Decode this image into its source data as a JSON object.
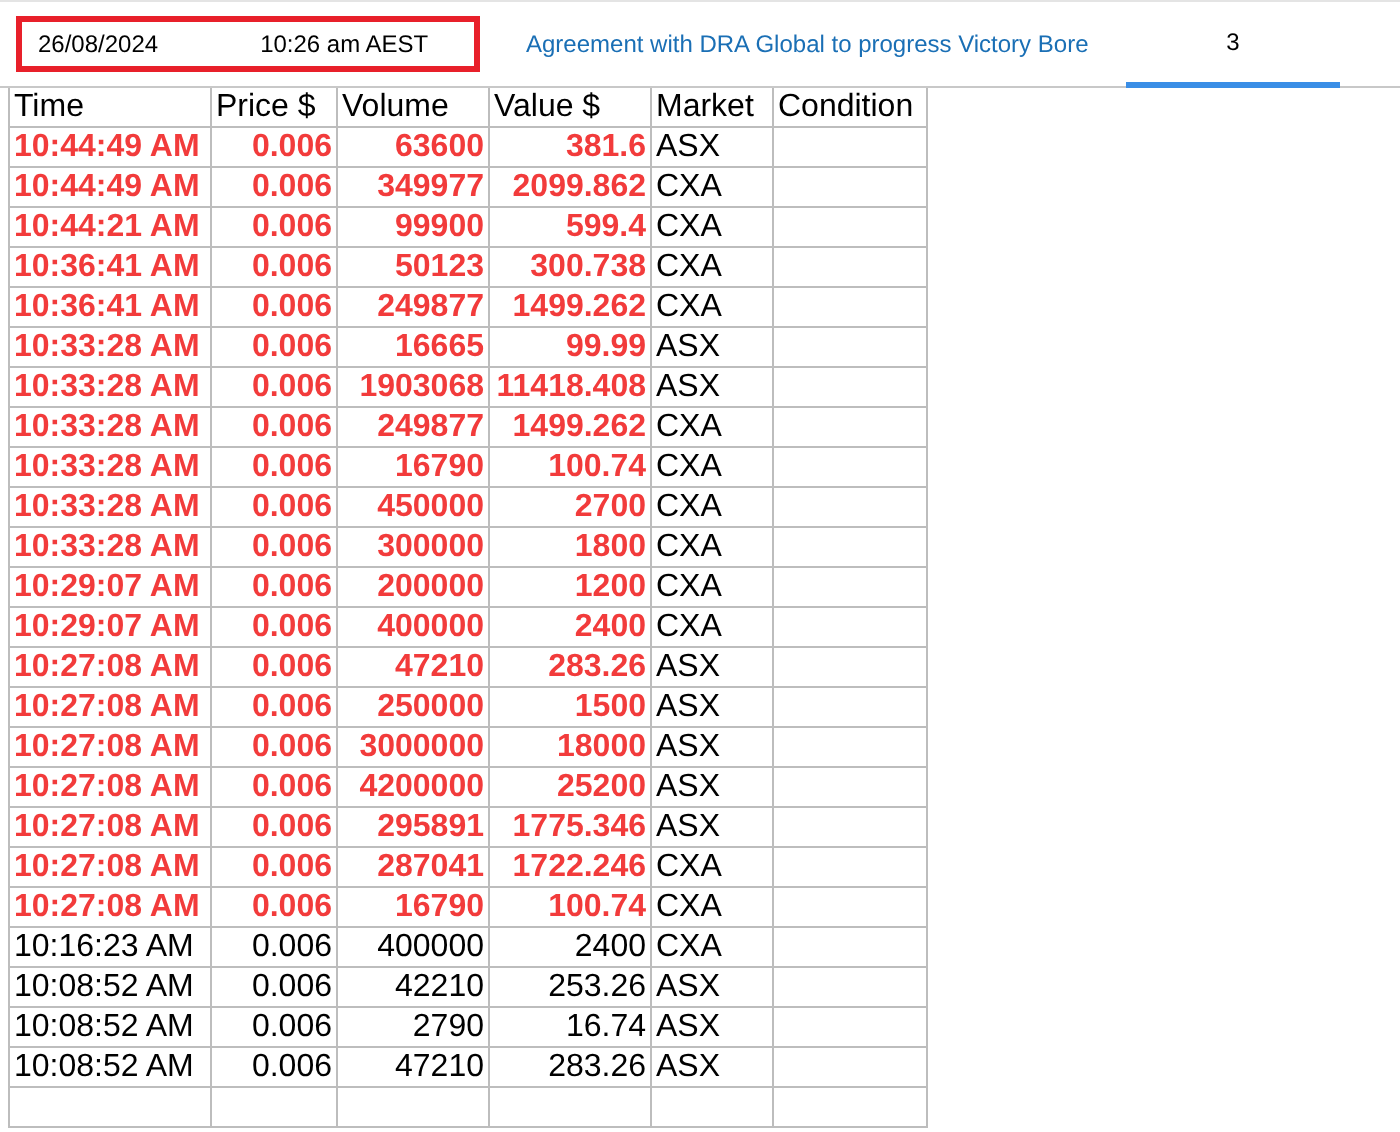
{
  "header": {
    "date": "26/08/2024",
    "time": "10:26 am AEST",
    "headline": "Agreement with DRA Global to progress Victory Bore",
    "count": "3"
  },
  "table": {
    "columns": [
      "Time",
      "Price $",
      "Volume",
      "Value $",
      "Market",
      "Condition"
    ],
    "rows": [
      {
        "time": "10:44:49 AM",
        "price": "0.006",
        "volume": "63600",
        "value": "381.6",
        "market": "ASX",
        "highlighted": true
      },
      {
        "time": "10:44:49 AM",
        "price": "0.006",
        "volume": "349977",
        "value": "2099.862",
        "market": "CXA",
        "highlighted": true
      },
      {
        "time": "10:44:21 AM",
        "price": "0.006",
        "volume": "99900",
        "value": "599.4",
        "market": "CXA",
        "highlighted": true
      },
      {
        "time": "10:36:41 AM",
        "price": "0.006",
        "volume": "50123",
        "value": "300.738",
        "market": "CXA",
        "highlighted": true
      },
      {
        "time": "10:36:41 AM",
        "price": "0.006",
        "volume": "249877",
        "value": "1499.262",
        "market": "CXA",
        "highlighted": true
      },
      {
        "time": "10:33:28 AM",
        "price": "0.006",
        "volume": "16665",
        "value": "99.99",
        "market": "ASX",
        "highlighted": true
      },
      {
        "time": "10:33:28 AM",
        "price": "0.006",
        "volume": "1903068",
        "value": "11418.408",
        "market": "ASX",
        "highlighted": true
      },
      {
        "time": "10:33:28 AM",
        "price": "0.006",
        "volume": "249877",
        "value": "1499.262",
        "market": "CXA",
        "highlighted": true
      },
      {
        "time": "10:33:28 AM",
        "price": "0.006",
        "volume": "16790",
        "value": "100.74",
        "market": "CXA",
        "highlighted": true
      },
      {
        "time": "10:33:28 AM",
        "price": "0.006",
        "volume": "450000",
        "value": "2700",
        "market": "CXA",
        "highlighted": true
      },
      {
        "time": "10:33:28 AM",
        "price": "0.006",
        "volume": "300000",
        "value": "1800",
        "market": "CXA",
        "highlighted": true
      },
      {
        "time": "10:29:07 AM",
        "price": "0.006",
        "volume": "200000",
        "value": "1200",
        "market": "CXA",
        "highlighted": true
      },
      {
        "time": "10:29:07 AM",
        "price": "0.006",
        "volume": "400000",
        "value": "2400",
        "market": "CXA",
        "highlighted": true
      },
      {
        "time": "10:27:08 AM",
        "price": "0.006",
        "volume": "47210",
        "value": "283.26",
        "market": "ASX",
        "highlighted": true
      },
      {
        "time": "10:27:08 AM",
        "price": "0.006",
        "volume": "250000",
        "value": "1500",
        "market": "ASX",
        "highlighted": true
      },
      {
        "time": "10:27:08 AM",
        "price": "0.006",
        "volume": "3000000",
        "value": "18000",
        "market": "ASX",
        "highlighted": true
      },
      {
        "time": "10:27:08 AM",
        "price": "0.006",
        "volume": "4200000",
        "value": "25200",
        "market": "ASX",
        "highlighted": true
      },
      {
        "time": "10:27:08 AM",
        "price": "0.006",
        "volume": "295891",
        "value": "1775.346",
        "market": "ASX",
        "highlighted": true
      },
      {
        "time": "10:27:08 AM",
        "price": "0.006",
        "volume": "287041",
        "value": "1722.246",
        "market": "CXA",
        "highlighted": true
      },
      {
        "time": "10:27:08 AM",
        "price": "0.006",
        "volume": "16790",
        "value": "100.74",
        "market": "CXA",
        "highlighted": true
      },
      {
        "time": "10:16:23 AM",
        "price": "0.006",
        "volume": "400000",
        "value": "2400",
        "market": "CXA",
        "highlighted": false
      },
      {
        "time": "10:08:52 AM",
        "price": "0.006",
        "volume": "42210",
        "value": "253.26",
        "market": "ASX",
        "highlighted": false
      },
      {
        "time": "10:08:52 AM",
        "price": "0.006",
        "volume": "2790",
        "value": "16.74",
        "market": "ASX",
        "highlighted": false
      },
      {
        "time": "10:08:52 AM",
        "price": "0.006",
        "volume": "47210",
        "value": "283.26",
        "market": "ASX",
        "highlighted": false
      }
    ]
  }
}
